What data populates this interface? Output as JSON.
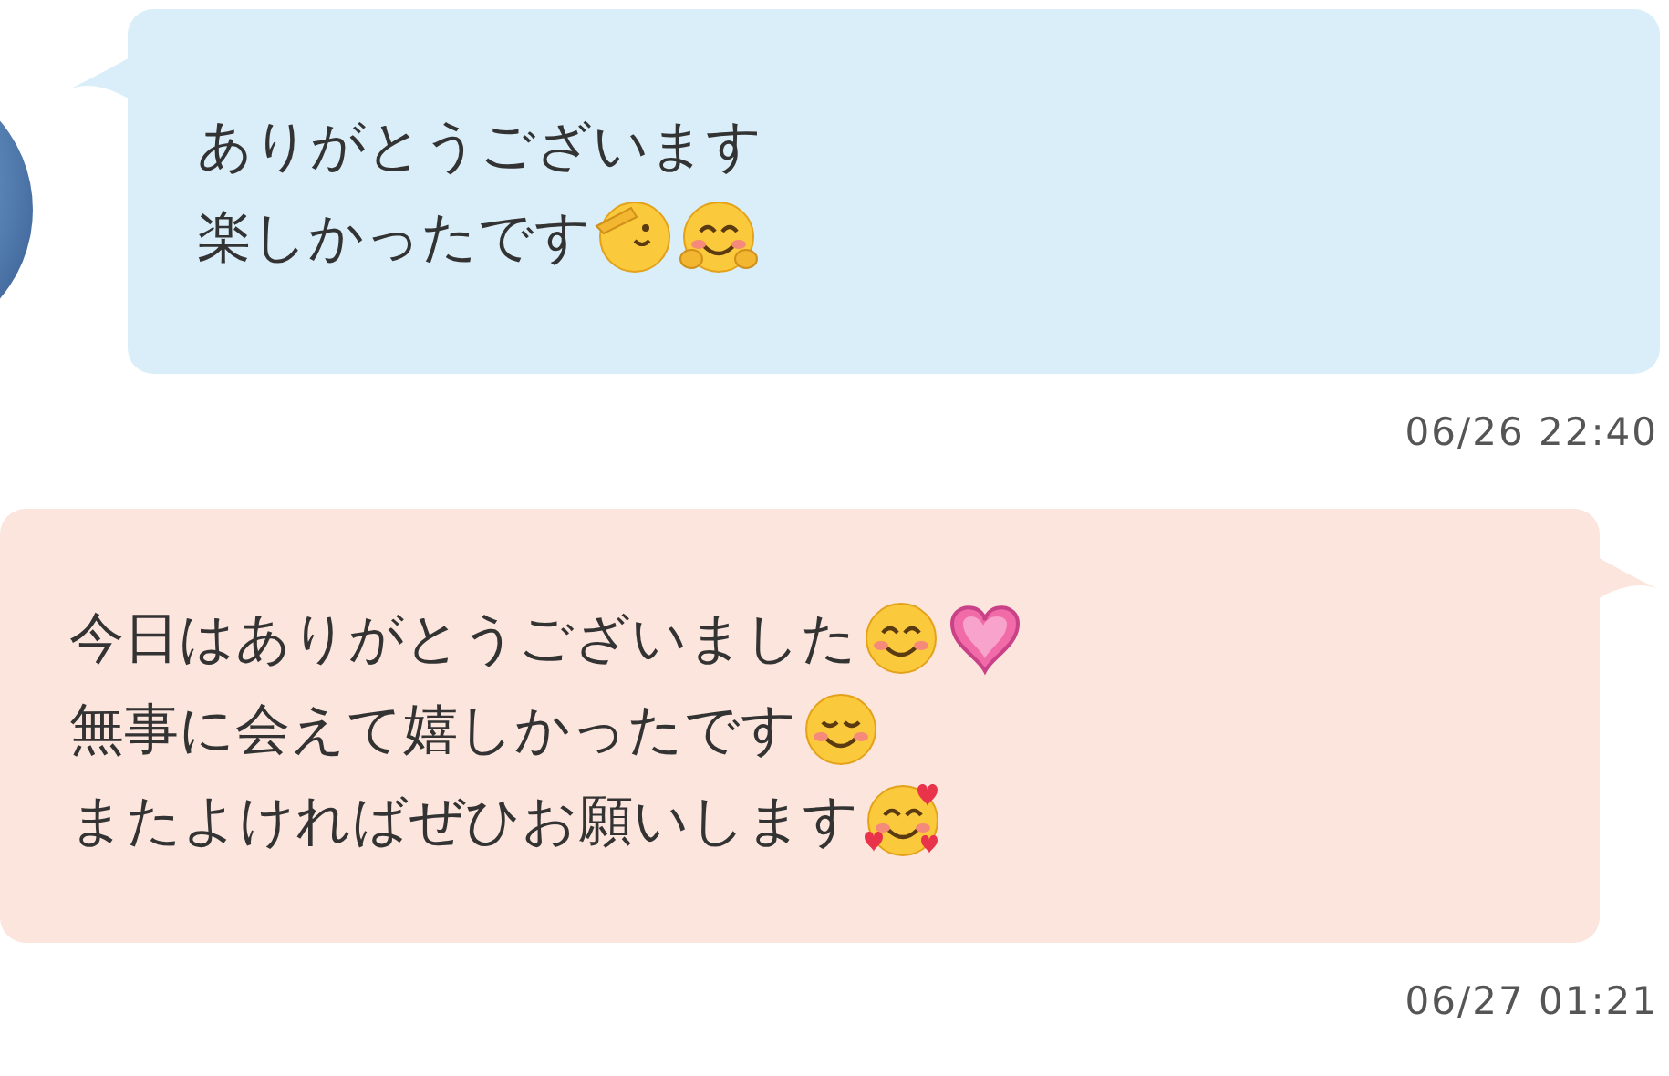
{
  "messages": [
    {
      "kind": "received",
      "lines": [
        {
          "text": "ありがとうございます"
        },
        {
          "text": "楽しかったです",
          "emojis": [
            {
              "kind": "salute"
            },
            {
              "kind": "hug"
            }
          ]
        }
      ],
      "time": "06/26 22:40"
    },
    {
      "kind": "sent",
      "lines": [
        {
          "text": "今日はありがとうございました",
          "emojis": [
            {
              "kind": "smile"
            },
            {
              "kind": "heart"
            }
          ]
        },
        {
          "text": "無事に会えて嬉しかったです",
          "emojis": [
            {
              "kind": "blush"
            }
          ]
        },
        {
          "text": "またよければぜひお願いします",
          "emojis": [
            {
              "kind": "hearts-face"
            }
          ]
        }
      ],
      "time": "06/27 01:21"
    }
  ]
}
